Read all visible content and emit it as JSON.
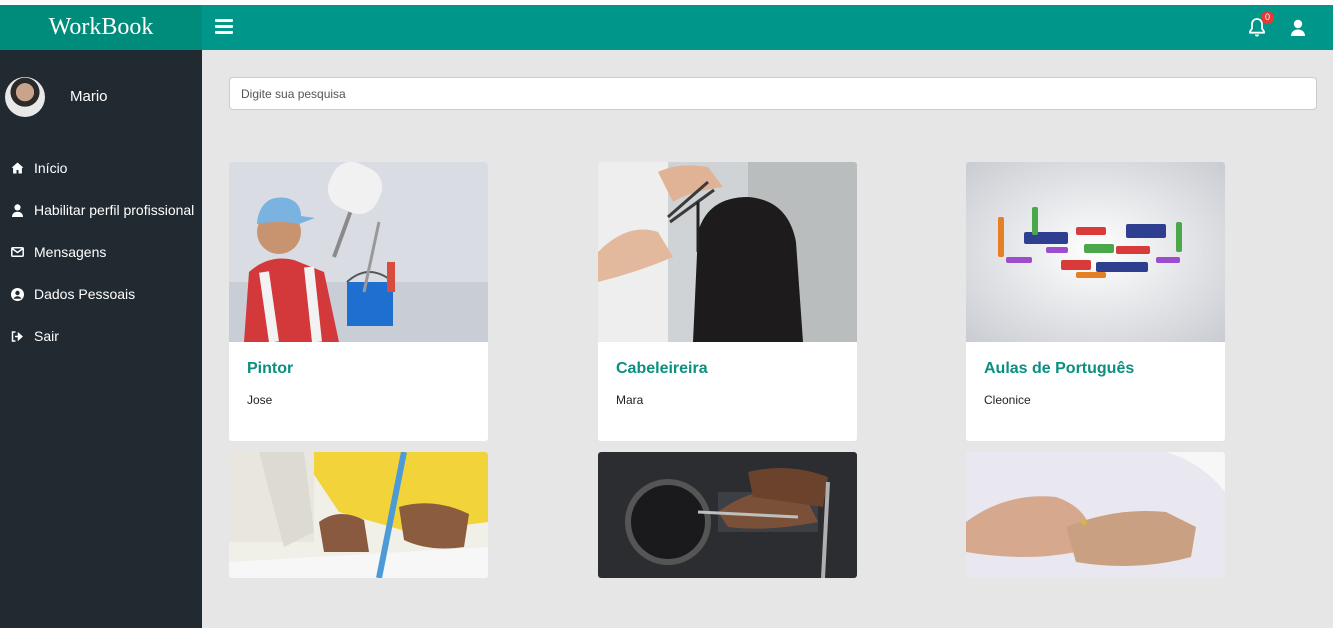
{
  "app": {
    "brand": "WorkBook"
  },
  "topbar": {
    "notification_count": "0"
  },
  "user": {
    "name": "Mario"
  },
  "sidebar": {
    "items": [
      {
        "label": "Início",
        "icon": "home-icon"
      },
      {
        "label": "Habilitar perfil profissional",
        "icon": "user-icon"
      },
      {
        "label": "Mensagens",
        "icon": "envelope-icon"
      },
      {
        "label": "Dados Pessoais",
        "icon": "user-circle-icon"
      },
      {
        "label": "Sair",
        "icon": "sign-out-icon"
      }
    ]
  },
  "search": {
    "placeholder": "Digite sua pesquisa"
  },
  "services": [
    {
      "title": "Pintor",
      "owner": "Jose"
    },
    {
      "title": "Cabeleireira",
      "owner": "Mara"
    },
    {
      "title": "Aulas de Português",
      "owner": "Cleonice"
    }
  ],
  "colors": {
    "primary": "#00968a",
    "brand_bg": "#008c7a",
    "sidebar_bg": "#212a30",
    "title_accent": "#0b8f7f",
    "badge": "#e53935"
  }
}
